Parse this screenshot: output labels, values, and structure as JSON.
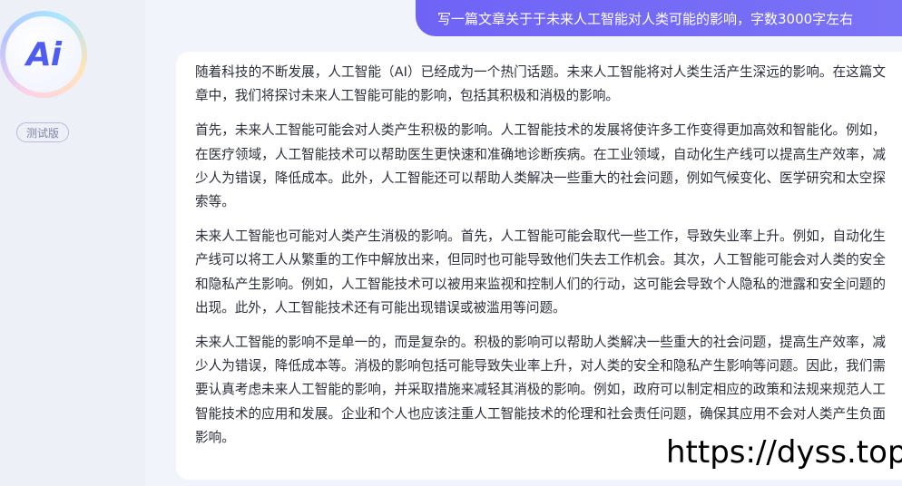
{
  "sidebar": {
    "avatar_text": "Ai",
    "badge_label": "测试版"
  },
  "user_message": "写一篇文章关于于未来人工智能对人类可能的影响，字数3000字左右",
  "answer": {
    "paragraphs": [
      "随着科技的不断发展，人工智能（AI）已经成为一个热门话题。未来人工智能将对人类生活产生深远的影响。在这篇文章中，我们将探讨未来人工智能可能的影响，包括其积极和消极的影响。",
      "首先，未来人工智能可能会对人类产生积极的影响。人工智能技术的发展将使许多工作变得更加高效和智能化。例如，在医疗领域，人工智能技术可以帮助医生更快速和准确地诊断疾病。在工业领域，自动化生产线可以提高生产效率，减少人为错误，降低成本。此外，人工智能还可以帮助人类解决一些重大的社会问题，例如气候变化、医学研究和太空探索等。",
      "未来人工智能也可能对人类产生消极的影响。首先，人工智能可能会取代一些工作，导致失业率上升。例如，自动化生产线可以将工人从繁重的工作中解放出来，但同时也可能导致他们失去工作机会。其次，人工智能可能会对人类的安全和隐私产生影响。例如，人工智能技术可以被用来监视和控制人们的行动，这可能会导致个人隐私的泄露和安全问题的出现。此外，人工智能技术还有可能出现错误或被滥用等问题。",
      "未来人工智能的影响不是单一的，而是复杂的。积极的影响可以帮助人类解决一些重大的社会问题，提高生产效率，减少人为错误，降低成本等。消极的影响包括可能导致失业率上升，对人类的安全和隐私产生影响等问题。因此，我们需要认真考虑未来人工智能的影响，并采取措施来减轻其消极的影响。例如，政府可以制定相应的政策和法规来规范人工智能技术的应用和发展。企业和个人也应该注重人工智能技术的伦理和社会责任问题，确保其应用不会对人类产生负面影响。"
    ]
  },
  "watermark": "https://dyss.top",
  "colors": {
    "accent": "#6f63f6",
    "avatar_text": "#4f5cf0",
    "background": "#eef0f8"
  }
}
